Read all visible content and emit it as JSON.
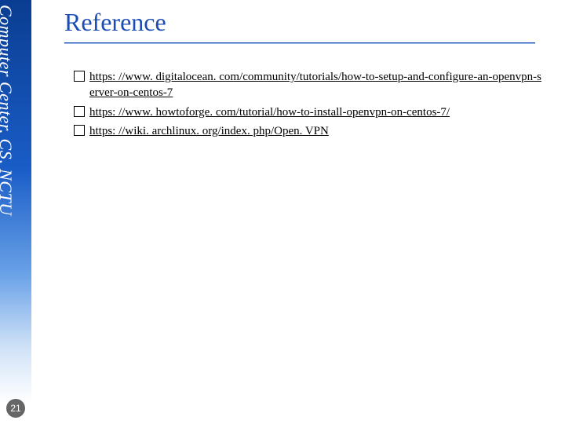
{
  "sidebar": {
    "label": "Computer Center, CS, NCTU"
  },
  "slide": {
    "title": "Reference",
    "page_number": "21"
  },
  "references": [
    {
      "url": "https: //www. digitalocean. com/community/tutorials/how-to-setup-and-configure-an-openvpn-server-on-centos-7"
    },
    {
      "url": "https: //www. howtoforge. com/tutorial/how-to-install-openvpn-on-centos-7/"
    },
    {
      "url": "https: //wiki. archlinux. org/index. php/Open. VPN"
    }
  ]
}
